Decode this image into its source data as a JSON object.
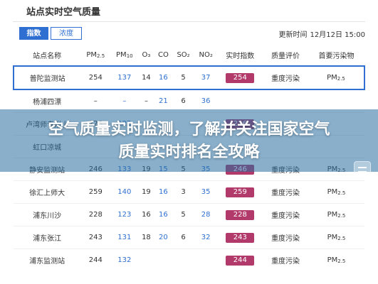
{
  "header": {
    "title": "站点实时空气质量"
  },
  "toggles": {
    "index_label": "指数",
    "concentration_label": "浓度"
  },
  "update": {
    "label": "更新时间",
    "time": "12月12日 15:00"
  },
  "columns": [
    "站点名称",
    "PM",
    "PM",
    "O₃",
    "CO",
    "SO₂",
    "NO₂",
    "实时指数",
    "质量评价",
    "首要污染物"
  ],
  "column_subs": {
    "pm25": "2.5",
    "pm10": "10"
  },
  "rows": [
    {
      "station": "普陀监测站",
      "pm25": "254",
      "pm10": "137",
      "o3": "14",
      "co": "16",
      "so2": "5",
      "no2": "37",
      "aqi": "254",
      "level": "重度污染",
      "pollutant": "PM",
      "pollutant_sub": "2.5",
      "highlight": true
    },
    {
      "station": "杨浦四漂",
      "pm25": "–",
      "pm10": "–",
      "o3": "–",
      "co": "21",
      "so2": "6",
      "no2": "36",
      "aqi": "",
      "level": "",
      "pollutant": "",
      "pollutant_sub": ""
    },
    {
      "station": "卢湾师专附小",
      "pm25": "226",
      "pm10": "122",
      "o3": "",
      "co": "",
      "so2": "",
      "no2": "",
      "aqi": "226",
      "level": "",
      "pollutant": "",
      "pollutant_sub": ""
    },
    {
      "station": "虹口凉城",
      "pm25": "",
      "pm10": "",
      "o3": "",
      "co": "",
      "so2": "",
      "no2": "",
      "aqi": "",
      "level": "",
      "pollutant": "",
      "pollutant_sub": ""
    },
    {
      "station": "静安监测站",
      "pm25": "246",
      "pm10": "133",
      "o3": "19",
      "co": "15",
      "so2": "5",
      "no2": "35",
      "aqi": "246",
      "level": "重度污染",
      "pollutant": "PM",
      "pollutant_sub": "2.5"
    },
    {
      "station": "徐汇上师大",
      "pm25": "259",
      "pm10": "140",
      "o3": "19",
      "co": "16",
      "so2": "3",
      "no2": "35",
      "aqi": "259",
      "level": "重度污染",
      "pollutant": "PM",
      "pollutant_sub": "2.5"
    },
    {
      "station": "浦东川沙",
      "pm25": "228",
      "pm10": "123",
      "o3": "16",
      "co": "16",
      "so2": "5",
      "no2": "28",
      "aqi": "228",
      "level": "重度污染",
      "pollutant": "PM",
      "pollutant_sub": "2.5"
    },
    {
      "station": "浦东张江",
      "pm25": "243",
      "pm10": "131",
      "o3": "18",
      "co": "20",
      "so2": "6",
      "no2": "32",
      "aqi": "243",
      "level": "重度污染",
      "pollutant": "PM",
      "pollutant_sub": "2.5"
    },
    {
      "station": "浦东监测站",
      "pm25": "244",
      "pm10": "132",
      "o3": "",
      "co": "",
      "so2": "",
      "no2": "",
      "aqi": "244",
      "level": "重度污染",
      "pollutant": "PM",
      "pollutant_sub": "2.5"
    }
  ],
  "overlay": {
    "line1": "空气质量实时监测，了解并关注国家空气",
    "line2": "质量实时排名全攻略"
  },
  "colors": {
    "accent": "#2f6fd1",
    "aqi_pill": "#b23a6b",
    "overlay": "#286ea0"
  }
}
